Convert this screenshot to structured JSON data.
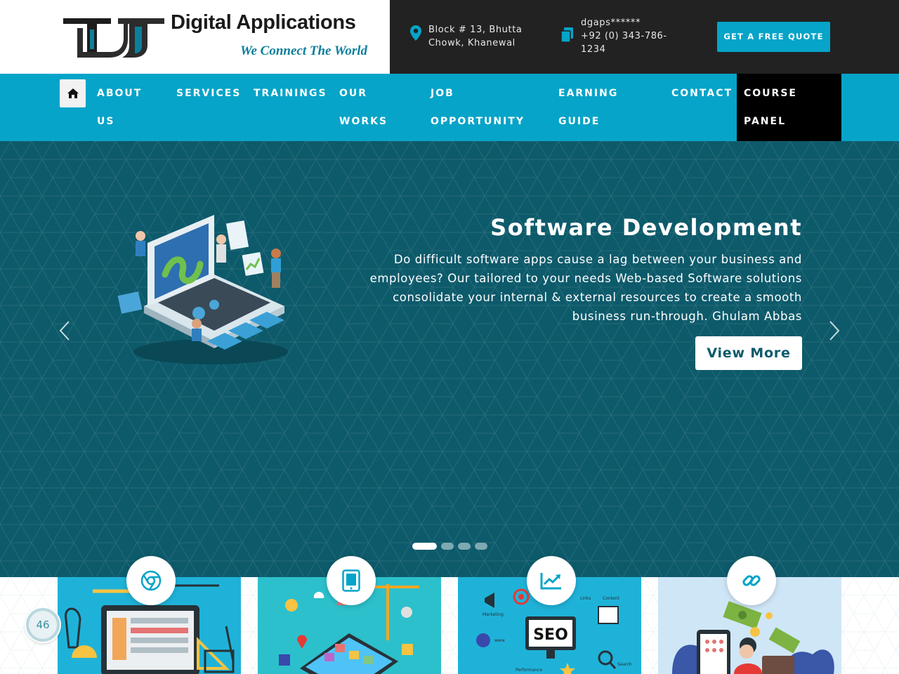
{
  "brand": {
    "title": "Digital Applications",
    "tagline": "We Connect The World"
  },
  "contact": {
    "address_line1": "Block # 13, Bhutta",
    "address_line2": "Chowk, Khanewal",
    "email": "dgaps******",
    "phone_line1": "+92 (0) 343-786-",
    "phone_line2": "1234",
    "quote_button": "GET A FREE QUOTE"
  },
  "nav": {
    "items": [
      {
        "line1": "ABOUT",
        "line2": "US"
      },
      {
        "line1": "SERVICES",
        "line2": ""
      },
      {
        "line1": "TRAININGS",
        "line2": ""
      },
      {
        "line1": "OUR",
        "line2": "WORKS"
      },
      {
        "line1": "JOB",
        "line2": "OPPORTUNITY"
      },
      {
        "line1": "EARNING",
        "line2": "GUIDE"
      },
      {
        "line1": "CONTACT",
        "line2": ""
      },
      {
        "line1": "COURSE",
        "line2": "PANEL"
      }
    ]
  },
  "hero": {
    "title": "Software Development",
    "text": "Do difficult software apps cause a lag between your business and employees? Our tailored to your needs Web-based Software solutions consolidate your internal & external resources to create a smooth business run-through. Ghulam Abbas",
    "button": "View More",
    "slide_count": 4,
    "active_slide": 1
  },
  "cards": [
    {
      "icon": "chrome-icon",
      "image": "web-design-illustration"
    },
    {
      "icon": "tablet-icon",
      "image": "app-development-illustration"
    },
    {
      "icon": "chart-line-icon",
      "image": "seo-illustration"
    },
    {
      "icon": "link-icon",
      "image": "online-earning-illustration"
    }
  ],
  "seo_labels": {
    "seo": "SEO",
    "marketing": "Marketing",
    "links": "Links",
    "content": "Content",
    "www": "www",
    "performance": "Performance",
    "search": "Search"
  },
  "counter": "46",
  "colors": {
    "accent": "#06a4c8",
    "dark": "#222222",
    "hero": "#0d5a6b",
    "active_nav": "#000000"
  }
}
